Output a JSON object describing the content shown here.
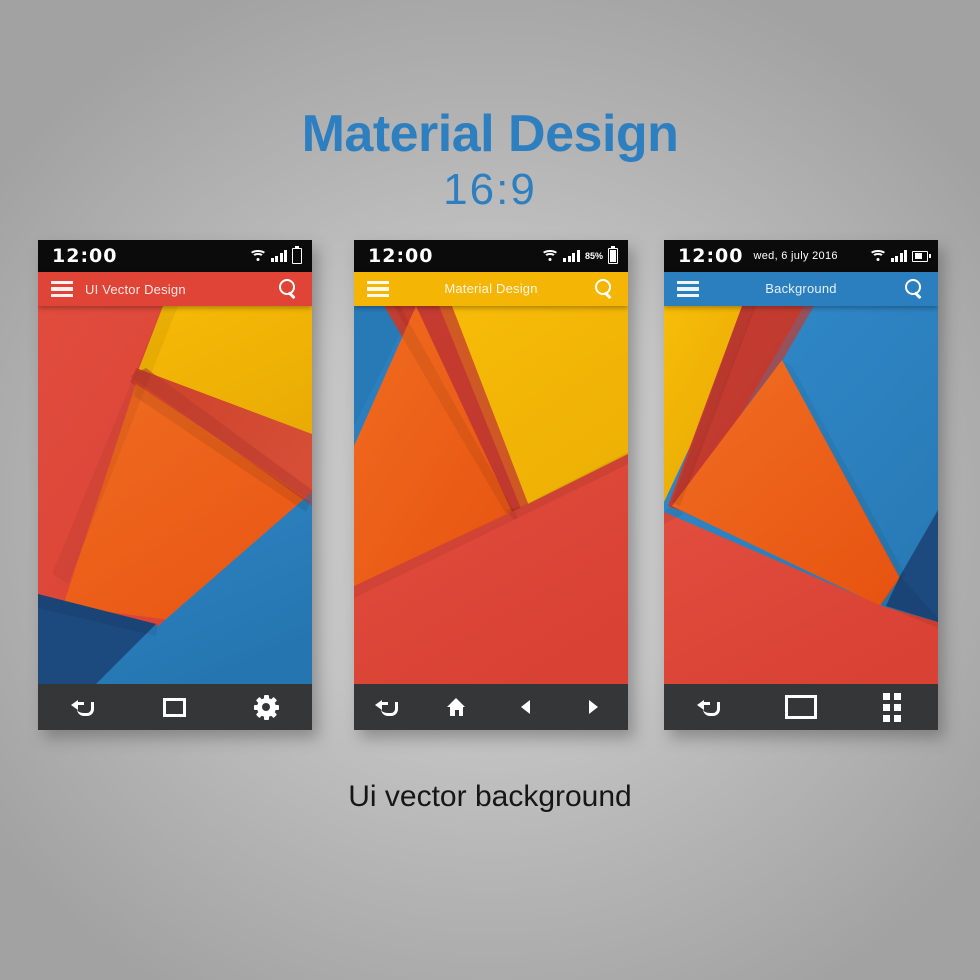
{
  "heading": {
    "title": "Material Design",
    "ratio": "16:9",
    "color": "#2e7fc0"
  },
  "caption": {
    "text": "Ui vector background",
    "color": "#161616"
  },
  "background": {
    "center_color": "#c9c9c9",
    "edge_color": "#a2a2a2"
  },
  "palette": {
    "red": "#df4436",
    "red_dark": "#c3392f",
    "yellow": "#f5b504",
    "yellow_dark": "#d99e03",
    "orange": "#eb5d19",
    "blue": "#2b7fbe",
    "navy": "#1c4a7e",
    "navbar": "#353638",
    "statusbar": "#0b0b0b"
  },
  "phones": [
    {
      "id": "phone-1",
      "statusbar": {
        "time": "12:00",
        "date": "",
        "battery_percent": "",
        "icons": [
          "wifi-icon",
          "signal-icon",
          "battery-icon"
        ]
      },
      "appbar": {
        "title": "UI Vector Design",
        "color": "#df4436",
        "title_align": "left",
        "menu_icon": "hamburger-menu-icon",
        "search_icon": "search-icon"
      },
      "wallpaper": "red-yellow-orange-blue-navy",
      "navbar": {
        "buttons": [
          {
            "name": "back-button",
            "icon": "back-arrow-icon"
          },
          {
            "name": "recents-button",
            "icon": "recents-square-icon"
          },
          {
            "name": "settings-button",
            "icon": "gear-icon"
          }
        ]
      }
    },
    {
      "id": "phone-2",
      "statusbar": {
        "time": "12:00",
        "date": "",
        "battery_percent": "85%",
        "icons": [
          "wifi-icon",
          "signal-icon",
          "battery-icon"
        ]
      },
      "appbar": {
        "title": "Material Design",
        "color": "#f5b504",
        "title_align": "center",
        "menu_icon": "hamburger-menu-icon",
        "search_icon": "search-icon"
      },
      "wallpaper": "blue-red-orange-yellow-red",
      "navbar": {
        "buttons": [
          {
            "name": "back-button",
            "icon": "back-arrow-icon"
          },
          {
            "name": "home-button",
            "icon": "home-icon"
          },
          {
            "name": "previous-button",
            "icon": "triangle-left-icon"
          },
          {
            "name": "next-button",
            "icon": "triangle-right-icon"
          }
        ]
      }
    },
    {
      "id": "phone-3",
      "statusbar": {
        "time": "12:00",
        "date": "wed, 6 july 2016",
        "battery_percent": "",
        "icons": [
          "wifi-icon",
          "signal-icon",
          "battery-icon"
        ]
      },
      "appbar": {
        "title": "Background",
        "color": "#2b7fbe",
        "title_align": "center",
        "menu_icon": "hamburger-menu-icon",
        "search_icon": "search-icon"
      },
      "wallpaper": "yellow-red-blue-orange-navy-red",
      "navbar": {
        "buttons": [
          {
            "name": "back-button",
            "icon": "back-arrow-icon"
          },
          {
            "name": "recents-button",
            "icon": "recents-rectangle-icon"
          },
          {
            "name": "apps-button",
            "icon": "grid-apps-icon"
          }
        ]
      }
    }
  ]
}
